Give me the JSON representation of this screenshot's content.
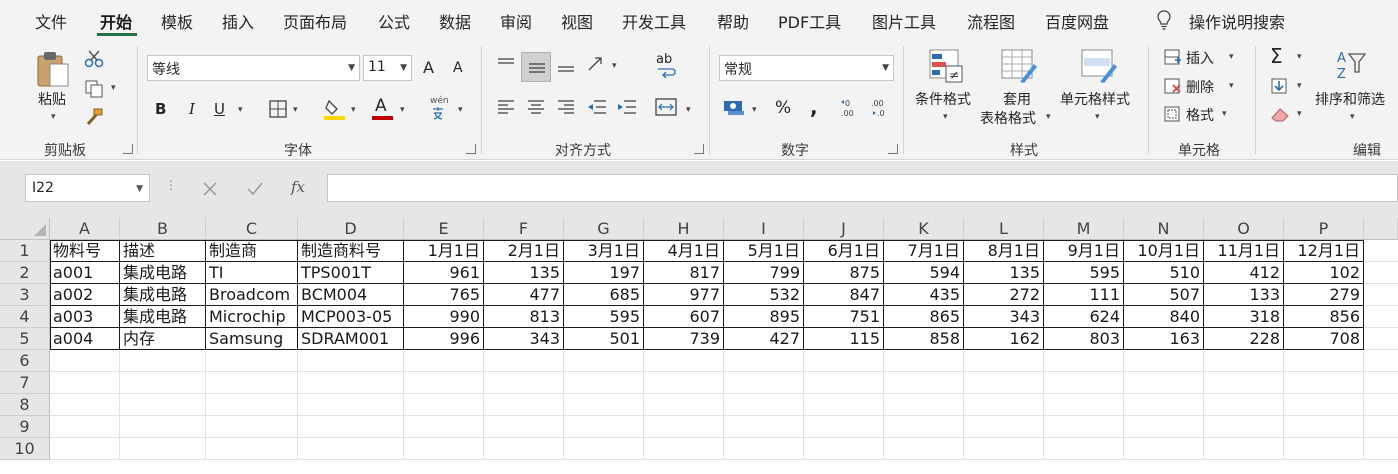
{
  "menu": {
    "items": [
      "文件",
      "开始",
      "模板",
      "插入",
      "页面布局",
      "公式",
      "数据",
      "审阅",
      "视图",
      "开发工具",
      "帮助",
      "PDF工具",
      "图片工具",
      "流程图",
      "百度网盘"
    ],
    "search": "操作说明搜索"
  },
  "ribbon": {
    "clipboard": {
      "paste": "粘贴",
      "label": "剪贴板"
    },
    "font": {
      "name": "等线",
      "size": "11",
      "label": "字体",
      "grow": "A",
      "shrink": "A",
      "bold": "B",
      "italic": "I",
      "underline": "U",
      "fontcolor": "A",
      "phonetic": "wén"
    },
    "alignment": {
      "label": "对齐方式",
      "wrap": "ab"
    },
    "number": {
      "format": "常规",
      "label": "数字",
      "percent": "%",
      "comma": ","
    },
    "styles": {
      "conditional": "条件格式",
      "table1": "套用",
      "table2": "表格格式",
      "cell_styles": "单元格样式",
      "label": "样式"
    },
    "cells": {
      "insert": "插入",
      "delete": "删除",
      "format": "格式",
      "label": "单元格"
    },
    "editing": {
      "sort": "排序和筛选",
      "label": "编辑"
    }
  },
  "formula_bar": {
    "cell_ref": "I22",
    "fx": "fx",
    "content": ""
  },
  "grid": {
    "columns": [
      "A",
      "B",
      "C",
      "D",
      "E",
      "F",
      "G",
      "H",
      "I",
      "J",
      "K",
      "L",
      "M",
      "N",
      "O",
      "P"
    ],
    "row_numbers": [
      "1",
      "2",
      "3",
      "4",
      "5",
      "6",
      "7",
      "8",
      "9",
      "10"
    ],
    "header_row": [
      "物料号",
      "描述",
      "制造商",
      "制造商料号",
      "1月1日",
      "2月1日",
      "3月1日",
      "4月1日",
      "5月1日",
      "6月1日",
      "7月1日",
      "8月1日",
      "9月1日",
      "10月1日",
      "11月1日",
      "12月1日"
    ],
    "rows": [
      [
        "a001",
        "集成电路",
        "TI",
        "TPS001T",
        "961",
        "135",
        "197",
        "817",
        "799",
        "875",
        "594",
        "135",
        "595",
        "510",
        "412",
        "102"
      ],
      [
        "a002",
        "集成电路",
        "Broadcom",
        "BCM004",
        "765",
        "477",
        "685",
        "977",
        "532",
        "847",
        "435",
        "272",
        "111",
        "507",
        "133",
        "279"
      ],
      [
        "a003",
        "集成电路",
        "Microchip",
        "MCP003-05",
        "990",
        "813",
        "595",
        "607",
        "895",
        "751",
        "865",
        "343",
        "624",
        "840",
        "318",
        "856"
      ],
      [
        "a004",
        "内存",
        "Samsung",
        "SDRAM001",
        "996",
        "343",
        "501",
        "739",
        "427",
        "115",
        "858",
        "162",
        "803",
        "163",
        "228",
        "708"
      ]
    ]
  },
  "colors": {
    "accent": "#217346",
    "fill_yellow": "#ffd700",
    "font_red": "#c00000",
    "blue_icon": "#2b6cb0"
  }
}
